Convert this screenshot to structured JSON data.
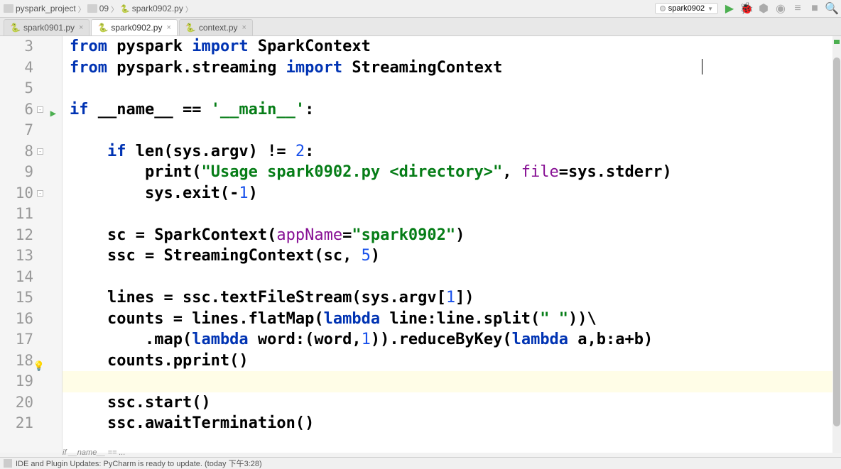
{
  "breadcrumb": {
    "project": "pyspark_project",
    "folder": "09",
    "file": "spark0902.py"
  },
  "run_config": "spark0902",
  "tabs": [
    {
      "name": "spark0901.py",
      "active": false
    },
    {
      "name": "spark0902.py",
      "active": true
    },
    {
      "name": "context.py",
      "active": false
    }
  ],
  "line_numbers": [
    "3",
    "4",
    "5",
    "6",
    "7",
    "8",
    "9",
    "10",
    "11",
    "12",
    "13",
    "14",
    "15",
    "16",
    "17",
    "18",
    "19",
    "20",
    "21"
  ],
  "code": {
    "l3": {
      "kw1": "from",
      "mod1": " pyspark ",
      "kw2": "import",
      "cls": " SparkContext"
    },
    "l4": {
      "kw1": "from",
      "mod1": " pyspark.streaming ",
      "kw2": "import",
      "cls": " StreamingContext"
    },
    "l6": {
      "kw": "if",
      "txt1": " __name__ == ",
      "str": "'__main__'",
      "txt2": ":"
    },
    "l8": {
      "indent": "    ",
      "kw": "if",
      "txt1": " len(sys.argv) != ",
      "num": "2",
      "txt2": ":"
    },
    "l9": {
      "indent": "        ",
      "txt1": "print(",
      "str": "\"Usage spark0902.py <directory>\"",
      "txt2": ", ",
      "param": "file",
      "txt3": "=sys.stderr)"
    },
    "l10": {
      "indent": "        ",
      "txt1": "sys.exit(-",
      "num": "1",
      "txt2": ")"
    },
    "l12": {
      "indent": "    ",
      "txt1": "sc = SparkContext(",
      "param": "appName",
      "txt2": "=",
      "str": "\"spark0902\"",
      "txt3": ")"
    },
    "l13": {
      "indent": "    ",
      "txt1": "ssc = StreamingContext(sc, ",
      "num": "5",
      "txt2": ")"
    },
    "l15": {
      "indent": "    ",
      "txt1": "lines = ssc.textFileStream(sys.argv[",
      "num": "1",
      "txt2": "])"
    },
    "l16": {
      "indent": "    ",
      "txt1": "counts = lines.flatMap(",
      "kw": "lambda",
      "txt2": " line:line.split(",
      "str": "\" \"",
      "txt3": "))\\"
    },
    "l17": {
      "indent": "        ",
      "txt1": ".map(",
      "kw1": "lambda",
      "txt2": " word:(word,",
      "num": "1",
      "txt3": ")).reduceByKey(",
      "kw2": "lambda",
      "txt4": " a,b:a+b)"
    },
    "l18": {
      "indent": "    ",
      "txt": "counts.pprint()"
    },
    "l20": {
      "indent": "    ",
      "txt": "ssc.start()"
    },
    "l21": {
      "indent": "    ",
      "txt": "ssc.awaitTermination()"
    }
  },
  "breadcrumb_bottom": "if __name__ == ...",
  "status_bar": "IDE and Plugin Updates: PyCharm is ready to update. (today 下午3:28)"
}
